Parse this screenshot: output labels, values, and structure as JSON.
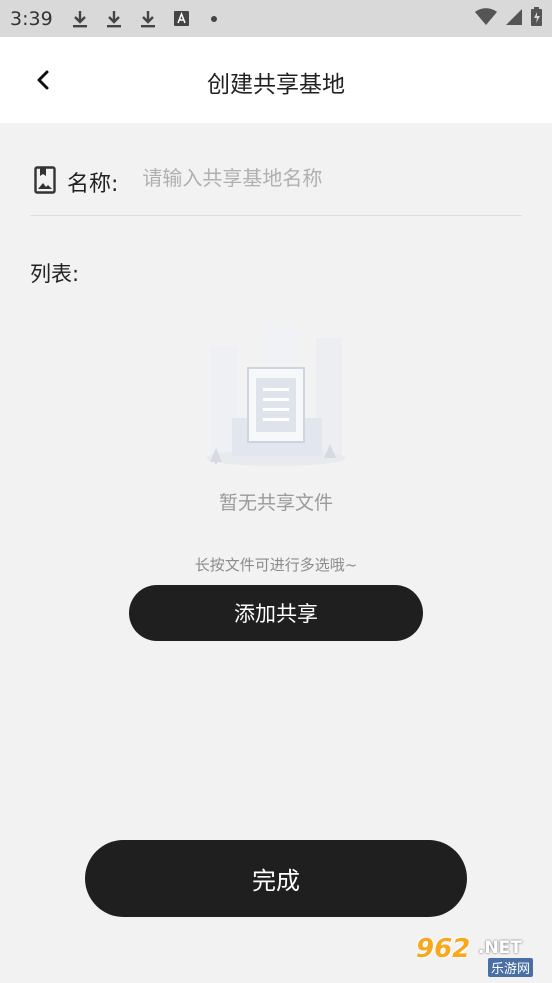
{
  "status_bar": {
    "time": "3:39",
    "left_icons": [
      "download-icon",
      "download-icon",
      "download-icon",
      "font-a-icon",
      "dot-icon"
    ],
    "right_icons": [
      "wifi-icon",
      "signal-icon",
      "battery-icon"
    ]
  },
  "header": {
    "back_icon": "chevron-left-icon",
    "title": "创建共享基地"
  },
  "name_field": {
    "icon": "bookmark-image-icon",
    "label": "名称:",
    "value": "",
    "placeholder": "请输入共享基地名称"
  },
  "list": {
    "label": "列表:"
  },
  "empty_state": {
    "illustration": "empty-document-illustration",
    "text": "暂无共享文件"
  },
  "hint": "长按文件可进行多选哦~",
  "buttons": {
    "add_share": "添加共享",
    "done": "完成"
  },
  "watermark": {
    "number": "962",
    "suffix": ".NET",
    "cn": "乐游网"
  },
  "colors": {
    "background": "#f2f2f2",
    "header_bg": "#ffffff",
    "button_bg": "#1f1f1f",
    "placeholder": "#b0b0b0",
    "muted_text": "#9a9a9a",
    "watermark_orange": "#f7a81c"
  }
}
